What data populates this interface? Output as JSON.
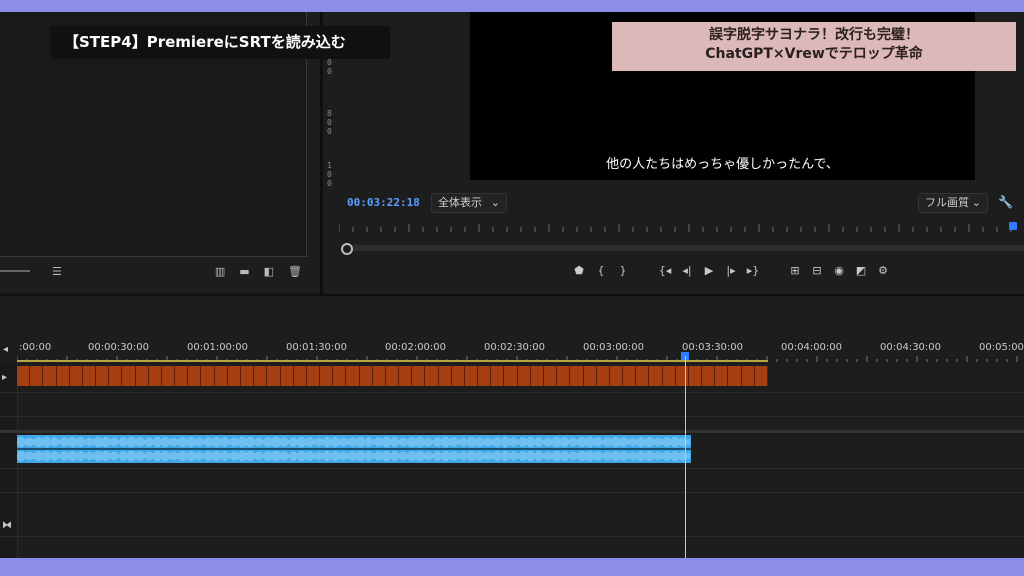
{
  "overlay": {
    "step_title": "【STEP4】PremiereにSRTを読み込む",
    "headline_line1": "誤字脱字サヨナラ！改行も完璧！",
    "headline_line2": "ChatGPT×Vrewでテロップ革命"
  },
  "program_monitor": {
    "subtitle_text": "他の人たちはめっちゃ優しかったんで、",
    "timecode": "00:03:22:18",
    "fit_dropdown": "全体表示",
    "quality_dropdown": "フル画質",
    "ruler_numbers": [
      "6",
      "0",
      "0",
      "8",
      "0",
      "0",
      "1",
      "0",
      "0"
    ]
  },
  "timeline": {
    "ruler_labels": [
      ":00:00",
      "00:00:30:00",
      "00:01:00:00",
      "00:01:30:00",
      "00:02:00:00",
      "00:02:30:00",
      "00:03:00:00",
      "00:03:30:00",
      "00:04:00:00",
      "00:04:30:00",
      "00:05:00"
    ]
  },
  "icons": {
    "source": [
      "insert-icon",
      "folder-icon",
      "export-icon",
      "trash-icon"
    ],
    "transport": [
      "marker-icon",
      "mark-in-icon",
      "mark-out-icon",
      "go-to-in-icon",
      "step-back-icon",
      "play-icon",
      "step-forward-icon",
      "go-to-out-icon",
      "lift-icon",
      "extract-icon",
      "camera-icon",
      "compare-icon",
      "settings-icon"
    ]
  },
  "colors": {
    "subtitle_clip": "#a33f10",
    "audio_clip": "#3fa8e8",
    "timecode": "#5aa0ff",
    "headline_bg": "#dcb8b8"
  }
}
